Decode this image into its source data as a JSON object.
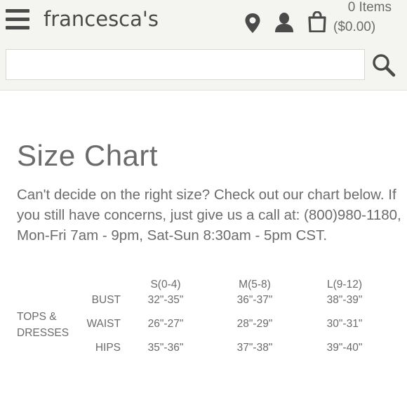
{
  "header": {
    "logo": "francesca's",
    "cart_count": "0 Items",
    "cart_total": "($0.00)"
  },
  "search": {
    "value": "",
    "placeholder": ""
  },
  "page": {
    "title": "Size Chart",
    "intro": "Can't decide on the right size? Check out our chart below. If you still have concerns, just give us a call at: (800)980-1180, Mon-Fri 7am - 9pm, Sat-Sun 8:30am - 5pm CST."
  },
  "size_table": {
    "columns": [
      "S(0-4)",
      "M(5-8)",
      "L(9-12)"
    ],
    "category_line1": "TOPS &",
    "category_line2": "DRESSES",
    "rows": [
      {
        "label": "BUST",
        "values": [
          "32\"-35\"",
          "36\"-37\"",
          "38\"-39\""
        ]
      },
      {
        "label": "WAIST",
        "values": [
          "26\"-27\"",
          "28\"-29\"",
          "30\"-31\""
        ]
      },
      {
        "label": "HIPS",
        "values": [
          "35\"-36\"",
          "37\"-38\"",
          "39\"-40\""
        ]
      }
    ]
  },
  "colors": {
    "header_bg": "#f4f4f0",
    "text": "#6b6b6b",
    "icon": "#4a4a4a"
  }
}
